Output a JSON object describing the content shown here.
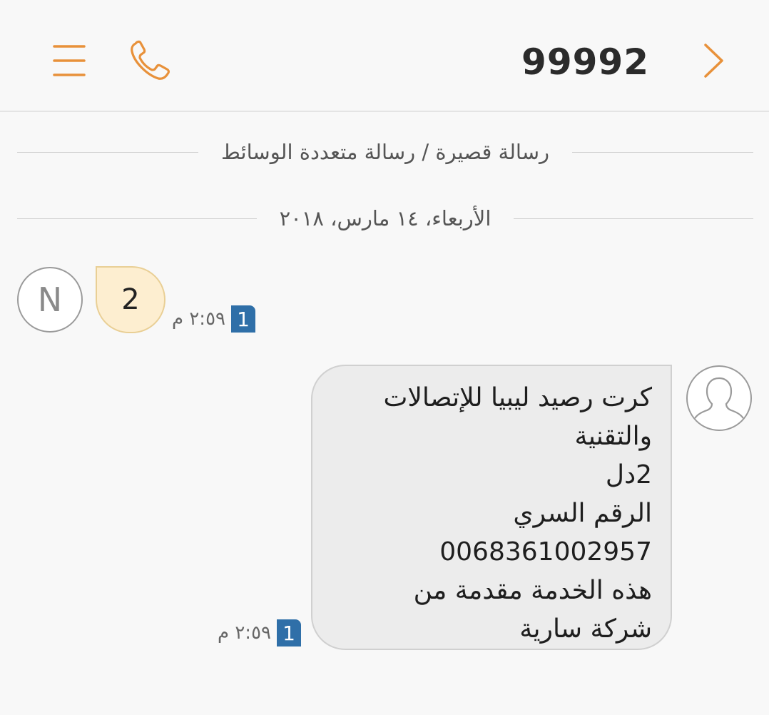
{
  "header": {
    "title": "99992"
  },
  "conversation": {
    "type_divider": "رسالة قصيرة / رسالة متعددة الوسائط",
    "date_divider": "الأربعاء، ١٤ مارس، ٢٠١٨",
    "incoming": {
      "avatar_letter": "N",
      "text": "2",
      "sim": "1",
      "time": "٢:٥٩ م"
    },
    "outgoing": {
      "lines": [
        "كرت رصيد ليبيا للإتصالات",
        "والتقنية",
        "2دل",
        "الرقم السري",
        "0068361002957",
        "هذه الخدمة مقدمة من",
        "شركة سارية"
      ],
      "sim": "1",
      "time": "٢:٥٩ م"
    }
  },
  "colors": {
    "accent": "#e8913a",
    "incoming_bubble": "#fdeed0",
    "outgoing_bubble": "#ececec",
    "sim_badge": "#2f6fa8"
  },
  "icons": {
    "menu": "menu-icon",
    "call": "phone-icon",
    "back": "chevron-right-icon",
    "avatar_user": "person-icon"
  }
}
